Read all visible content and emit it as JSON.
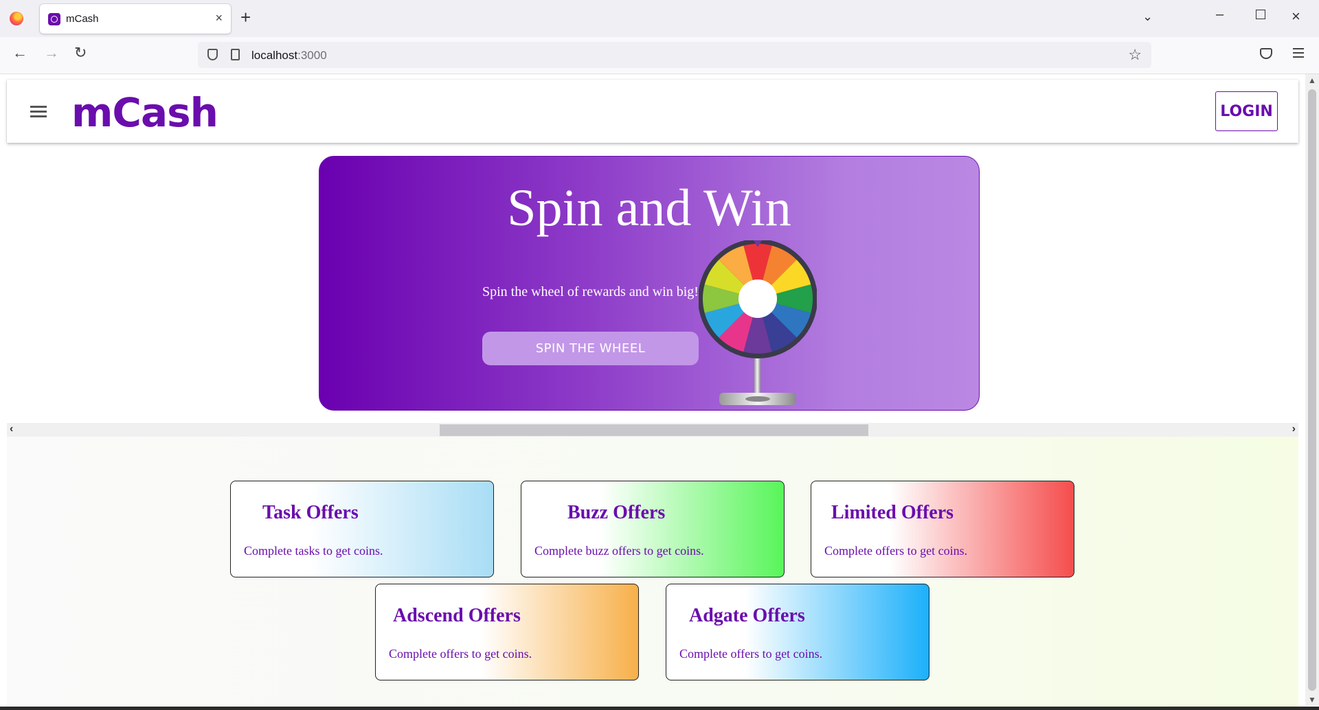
{
  "browser": {
    "tab_title": "mCash",
    "url_host": "localhost",
    "url_port": ":3000"
  },
  "app": {
    "brand": "mCash",
    "login_label": "LOGIN"
  },
  "hero": {
    "title": "Spin and Win",
    "subtitle": "Spin the wheel of rewards and win big!",
    "button_label": "SPIN THE WHEEL",
    "wheel_colors": [
      "#ee3338",
      "#f58230",
      "#fbd826",
      "#22a04a",
      "#2e76c0",
      "#383f95",
      "#6b3a9a",
      "#e7358b",
      "#2aa6de",
      "#8dc63f",
      "#d7de2a",
      "#fbac42"
    ]
  },
  "offers": [
    {
      "title": "Task Offers",
      "description": "Complete tasks to get coins."
    },
    {
      "title": "Buzz Offers",
      "description": "Complete buzz offers to get coins."
    },
    {
      "title": "Limited Offers",
      "description": "Complete offers to get coins."
    },
    {
      "title": "Adscend Offers",
      "description": "Complete offers to get coins."
    },
    {
      "title": "Adgate Offers",
      "description": "Complete offers to get coins."
    }
  ],
  "colors": {
    "brand": "#6a0dad",
    "hero_start": "#6a00b0",
    "hero_end": "#ba88e3"
  }
}
